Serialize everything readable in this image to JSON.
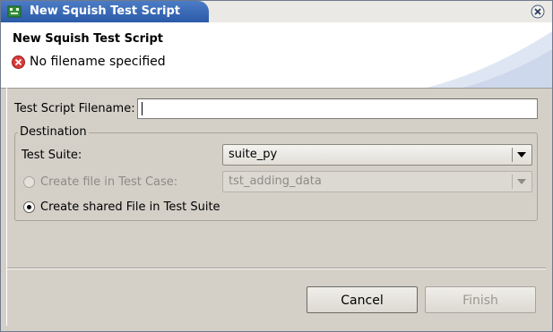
{
  "window": {
    "title": "New Squish Test Script"
  },
  "header": {
    "title": "New Squish Test Script",
    "message": "No filename specified"
  },
  "form": {
    "filename_label": "Test Script Filename:",
    "filename_value": "",
    "group_label": "Destination",
    "suite_label": "Test Suite:",
    "suite_value": "suite_py",
    "testcase_label": "Create file in Test Case:",
    "testcase_value": "tst_adding_data",
    "shared_label": "Create shared File in Test Suite",
    "testcase_selected": false,
    "shared_selected": true
  },
  "buttons": {
    "cancel": "Cancel",
    "finish": "Finish"
  },
  "icons": {
    "app": "squish-icon",
    "close": "close-icon",
    "error": "error-icon",
    "dropdown": "chevron-down-icon"
  },
  "colors": {
    "titlebar": "#2b5aa8",
    "error": "#d83b3b",
    "background": "#d4d0c8"
  }
}
